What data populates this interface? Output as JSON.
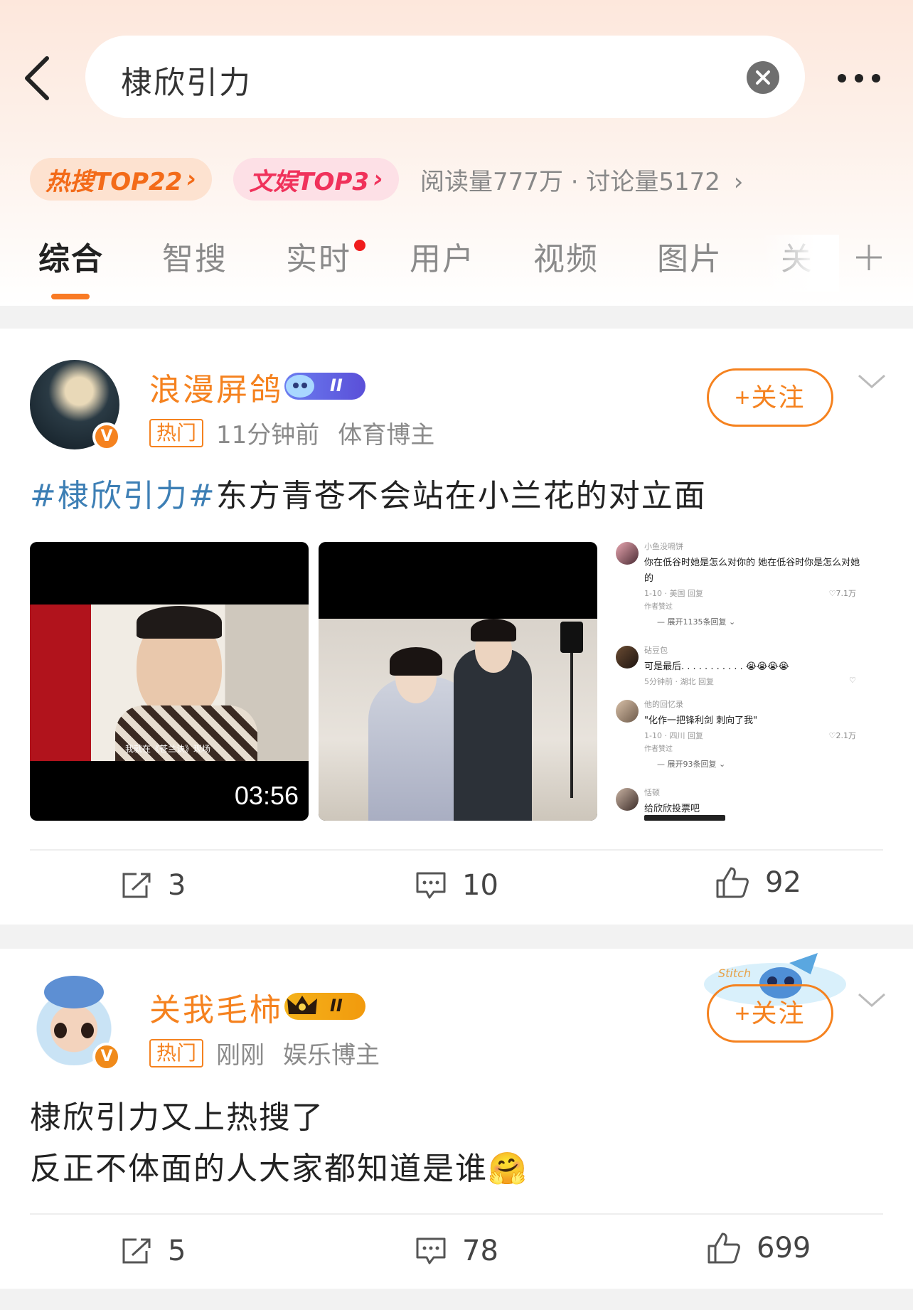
{
  "search": {
    "query": "棣欣引力"
  },
  "tags": {
    "hot": "热搜TOP22",
    "ent": "文娱TOP3",
    "stats": "阅读量777万 · 讨论量5172"
  },
  "tabs": [
    "综合",
    "智搜",
    "实时",
    "用户",
    "视频",
    "图片",
    "关"
  ],
  "posts": [
    {
      "username": "浪漫屏鸽",
      "level": "II",
      "hot_badge": "热门",
      "time": "11分钟前",
      "category": "体育博主",
      "follow_label": "+关注",
      "hashtag": "#棣欣引力#",
      "text": "东方青苍不会站在小兰花的对立面",
      "video_duration": "03:56",
      "video_caption": "我就在《苍兰诀》现场",
      "repost": "3",
      "comment": "10",
      "like": "92"
    },
    {
      "username": "关我毛柿",
      "level": "II",
      "hot_badge": "热门",
      "time": "刚刚",
      "category": "娱乐博主",
      "follow_label": "+关注",
      "line1": "棣欣引力又上热搜了",
      "line2": "反正不体面的人大家都知道是谁",
      "emoji": "🤗",
      "repost": "5",
      "comment": "78",
      "like": "699"
    }
  ],
  "comments": [
    {
      "name": "小鱼没嗝饼",
      "text": "你在低谷时她是怎么对你的 她在低谷时你是怎么对她",
      "text2": "的",
      "meta": "1-10 · 美国   回复",
      "likes": "♡7.1万",
      "badge": "作者赞过",
      "expand": "— 展开1135条回复 ⌄"
    },
    {
      "name": "砧豆包",
      "text": "可是最后. . . . . . . . . . . 😭😭😭😭",
      "meta": "5分钟前 · 湖北   回复",
      "likes": "♡"
    },
    {
      "name": "他的回忆录",
      "text": "\"化作一把锋利剑 刺向了我\"",
      "meta": "1-10 · 四川   回复",
      "likes": "♡2.1万",
      "badge": "作者赞过",
      "expand": "— 展开93条回复 ⌄"
    },
    {
      "name": "恬顿",
      "text": "给欣欣投票吧"
    }
  ]
}
